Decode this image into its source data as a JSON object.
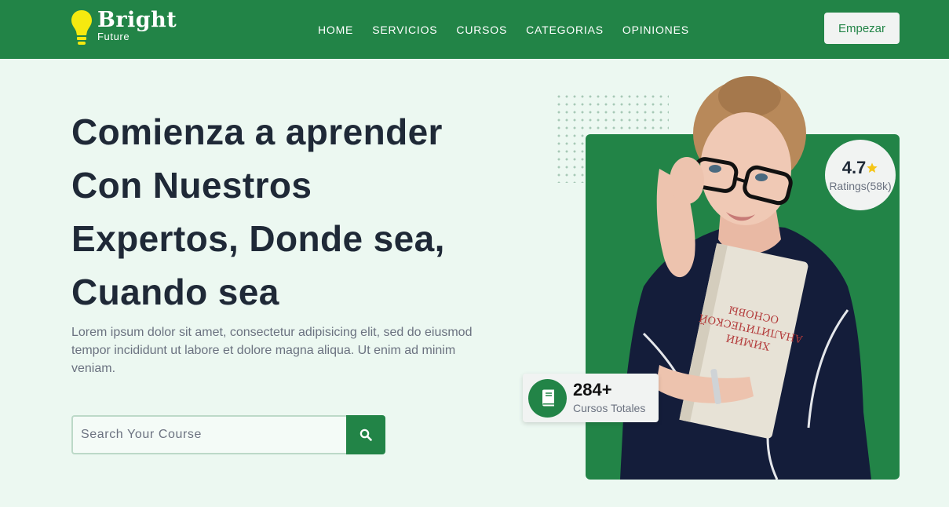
{
  "brand": {
    "name": "Bright",
    "tagline": "Future",
    "logo_icon": "lightbulb-icon"
  },
  "nav": {
    "items": [
      {
        "label": "HOME"
      },
      {
        "label": "SERVICIOS"
      },
      {
        "label": "CURSOS"
      },
      {
        "label": "CATEGORIAS"
      },
      {
        "label": "OPINIONES"
      }
    ],
    "cta_label": "Empezar"
  },
  "hero": {
    "title_lines": [
      "Comienza a aprender",
      "Con Nuestros",
      "Expertos, Donde sea,",
      "Cuando sea"
    ],
    "description": "Lorem ipsum dolor sit amet, consectetur adipisicing elit, sed do eiusmod tempor incididunt ut labore et dolore magna aliqua. Ut enim ad minim veniam.",
    "search": {
      "placeholder": "Search Your Course",
      "icon": "search-icon"
    }
  },
  "rating": {
    "value": "4.7",
    "label": "Ratings(58k)",
    "icon": "star-icon"
  },
  "courses": {
    "count": "284+",
    "label": "Cursos Totales",
    "icon": "book-icon"
  },
  "colors": {
    "primary": "#228447",
    "background": "#ecf8f1",
    "heading": "#1f2937",
    "text_muted": "#6b7280",
    "star": "#f5c518"
  }
}
